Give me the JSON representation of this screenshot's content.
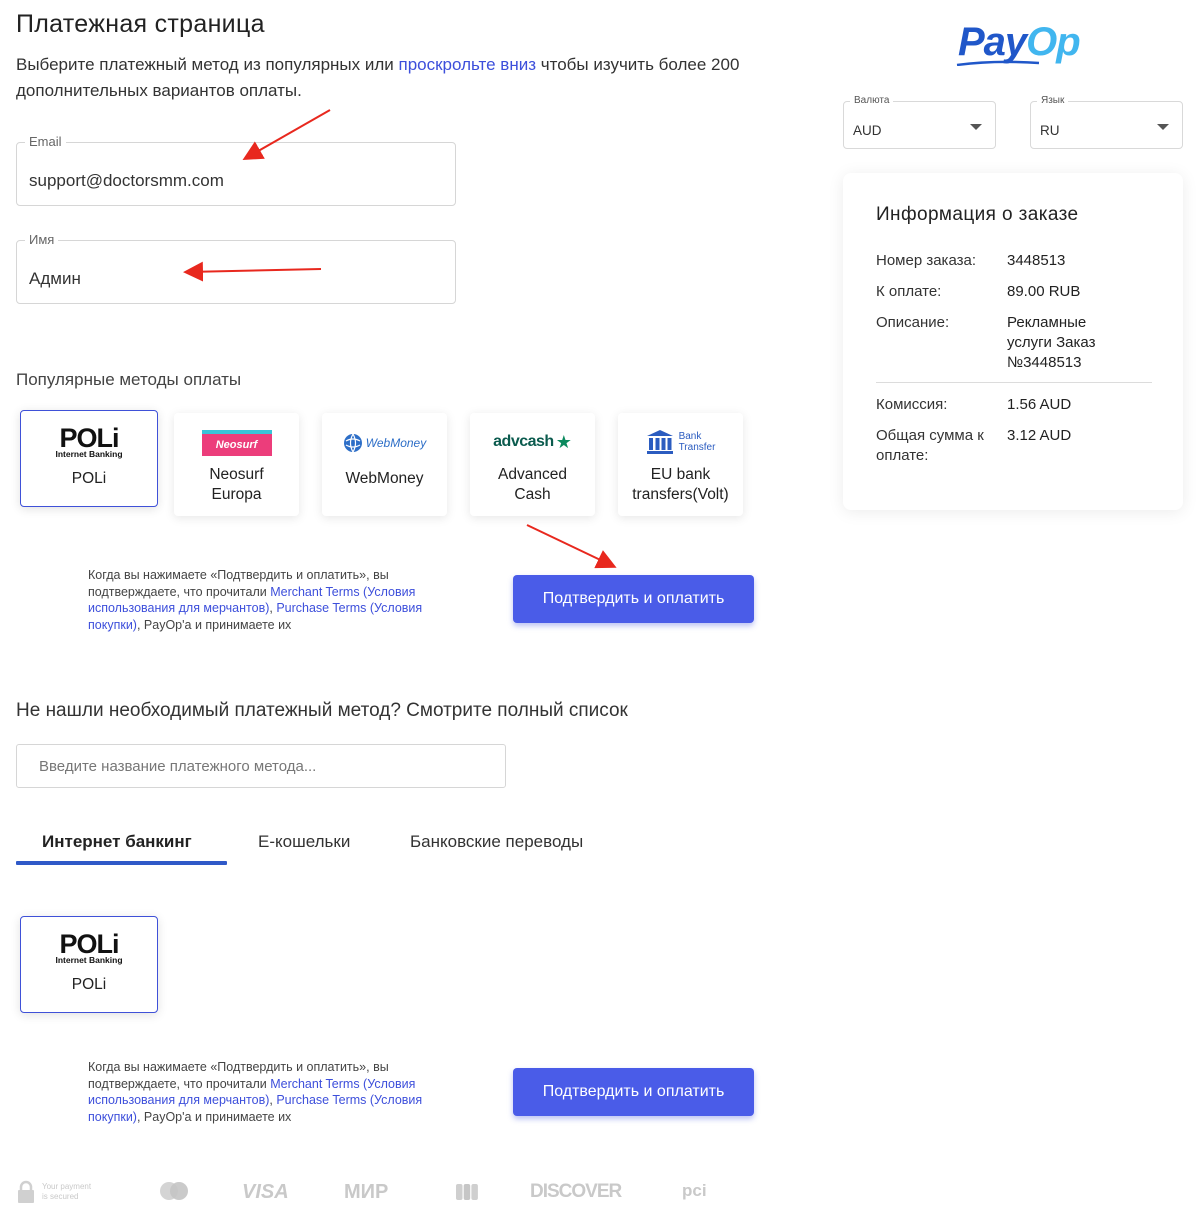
{
  "header": {
    "title": "Платежная страница",
    "intro_before": "Выберите платежный метод из популярных или ",
    "intro_link": "проскрольте вниз",
    "intro_after": " чтобы изучить более 200 дополнительных вариантов оплаты."
  },
  "form": {
    "email_label": "Email",
    "email_value": "support@doctorsmm.com",
    "name_label": "Имя",
    "name_value": "Админ"
  },
  "popular": {
    "label": "Популярные методы оплаты",
    "methods": [
      {
        "name": "POLi",
        "logo_main": "POLi",
        "logo_sub": "Internet Banking"
      },
      {
        "name_line1": "Neosurf",
        "name_line2": "Europa",
        "logo": "Neosurf"
      },
      {
        "name": "WebMoney",
        "logo": "WebMoney"
      },
      {
        "name_line1": "Advanced",
        "name_line2": "Cash",
        "logo": "advcash"
      },
      {
        "name_line1": "EU bank",
        "name_line2": "transfers(Volt)",
        "logo_line1": "Bank",
        "logo_line2": "Transfer"
      }
    ]
  },
  "terms": {
    "part1": "Когда вы нажимаете «Подтвердить и оплатить», вы подтверждаете, что прочитали ",
    "link1": "Merchant Terms (Условия использования для мерчантов)",
    "sep": ", ",
    "link2": "Purchase Terms (Условия покупки)",
    "part2": ", PayOp'а и принимаете их"
  },
  "confirm_button": "Подтвердить и оплатить",
  "search": {
    "heading": "Не нашли необходимый платежный метод? Смотрите полный список",
    "placeholder": "Введите название платежного метода..."
  },
  "tabs": [
    {
      "label": "Интернет банкинг",
      "active": true
    },
    {
      "label": "Е-кошельки",
      "active": false
    },
    {
      "label": "Банковские переводы",
      "active": false
    }
  ],
  "footer": {
    "secure_line1": "Your payment",
    "secure_line2": "is secured",
    "visa": "VISA",
    "mir": "МИР",
    "discover": "DISCOVER",
    "pci": "pci"
  },
  "brand": {
    "pay": "Pay",
    "op": "Op"
  },
  "selectors": {
    "currency_label": "Валюта",
    "currency_value": "AUD",
    "language_label": "Язык",
    "language_value": "RU"
  },
  "order": {
    "title": "Информация о заказе",
    "rows": [
      {
        "key": "Номер заказа:",
        "value": "3448513"
      },
      {
        "key": "К оплате:",
        "value": "89.00 RUB"
      },
      {
        "key": "Описание:",
        "value": "Рекламные услуги Заказ №3448513"
      },
      {
        "key": "Комиссия:",
        "value": "1.56 AUD"
      },
      {
        "key": "Общая сумма к оплате:",
        "value": "3.12 AUD"
      }
    ]
  },
  "colors": {
    "accent": "#4a5ce8",
    "link": "#3d4fdb",
    "annotation_arrow": "#e8281e",
    "brand_blue": "#2057c9",
    "brand_light": "#41b6ef"
  }
}
